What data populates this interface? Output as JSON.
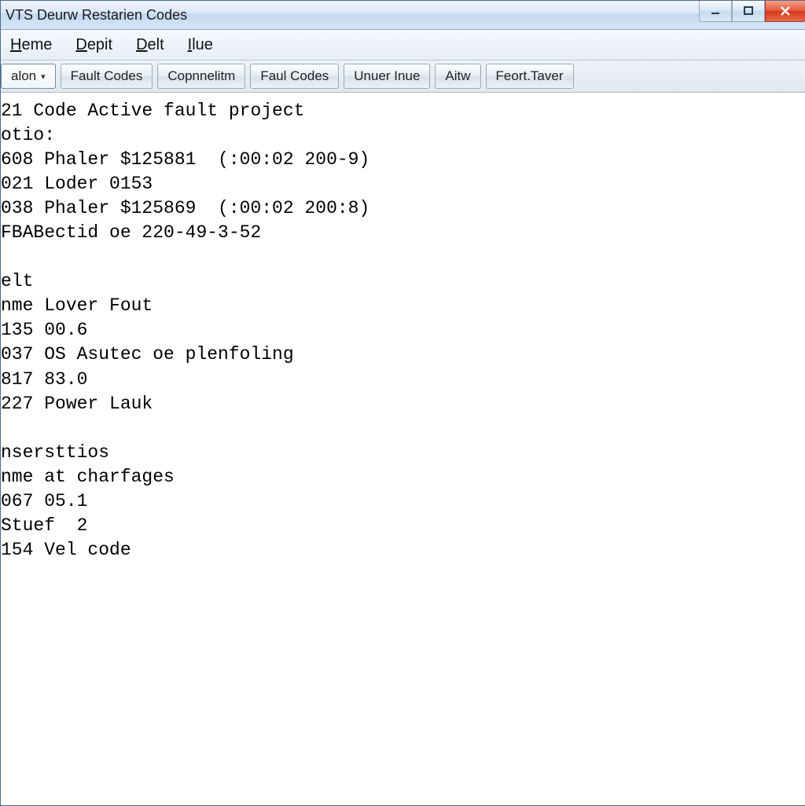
{
  "window": {
    "title": "VTS Deurw Restarien Codes"
  },
  "menu": {
    "items": [
      {
        "label": "Heme",
        "u": 0
      },
      {
        "label": "Depit",
        "u": 0
      },
      {
        "label": "Delt",
        "u": 0
      },
      {
        "label": "Ilue",
        "u": 0
      }
    ]
  },
  "tabs": [
    {
      "label": "alon",
      "active": true,
      "dropdown": true
    },
    {
      "label": "Fault Codes"
    },
    {
      "label": "Copnnelitm"
    },
    {
      "label": "Faul Codes"
    },
    {
      "label": "Unuer Inue"
    },
    {
      "label": "Aitw"
    },
    {
      "label": "Feort.Taver"
    }
  ],
  "content": {
    "lines": [
      "21 Code Active fault project",
      "otio:",
      "608 Phaler $125881  (:00:02 200-9)",
      "021 Loder 0153",
      "038 Phaler $125869  (:00:02 200:8)",
      "FBABectid oe 220-49-3-52",
      "",
      "elt",
      "nme Lover Fout",
      "135 00.6",
      "037 OS Asutec oe plenfoling",
      "817 83.0",
      "227 Power Lauk",
      "",
      "nsersttios",
      "nme at charfages",
      "067 05.1",
      "Stuef  2",
      "154 Vel code"
    ]
  }
}
